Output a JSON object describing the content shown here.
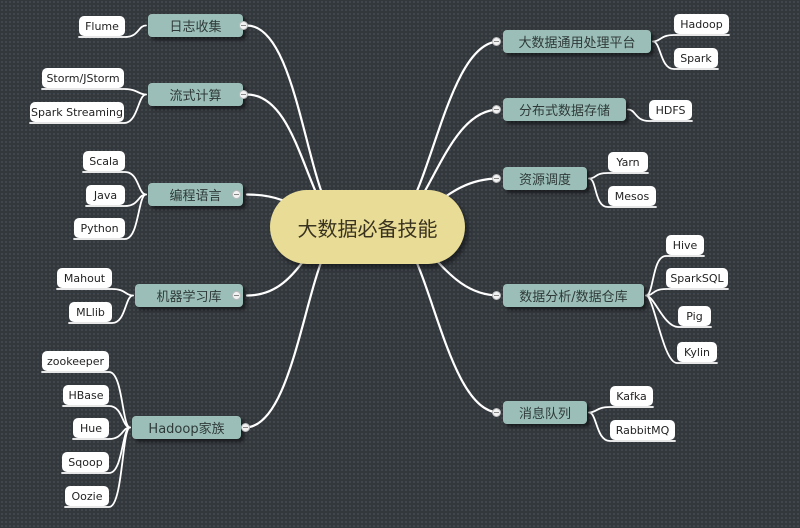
{
  "mindmap": {
    "root": "大数据必备技能",
    "left": [
      {
        "label": "日志收集",
        "children": [
          "Flume"
        ]
      },
      {
        "label": "流式计算",
        "children": [
          "Storm/JStorm",
          "Spark Streaming"
        ]
      },
      {
        "label": "编程语言",
        "children": [
          "Scala",
          "Java",
          "Python"
        ]
      },
      {
        "label": "机器学习库",
        "children": [
          "Mahout",
          "MLlib"
        ]
      },
      {
        "label": "Hadoop家族",
        "children": [
          "zookeeper",
          "HBase",
          "Hue",
          "Sqoop",
          "Oozie"
        ]
      }
    ],
    "right": [
      {
        "label": "大数据通用处理平台",
        "children": [
          "Hadoop",
          "Spark"
        ]
      },
      {
        "label": "分布式数据存储",
        "children": [
          "HDFS"
        ]
      },
      {
        "label": "资源调度",
        "children": [
          "Yarn",
          "Mesos"
        ]
      },
      {
        "label": "数据分析/数据仓库",
        "children": [
          "Hive",
          "SparkSQL",
          "Pig",
          "Kylin"
        ]
      },
      {
        "label": "消息队列",
        "children": [
          "Kafka",
          "RabbitMQ"
        ]
      }
    ]
  },
  "colors": {
    "background": "#33383d",
    "root_fill": "#e8dc96",
    "branch_fill": "#9bbfb8",
    "leaf_fill": "#ffffff",
    "connector": "#ffffff"
  }
}
